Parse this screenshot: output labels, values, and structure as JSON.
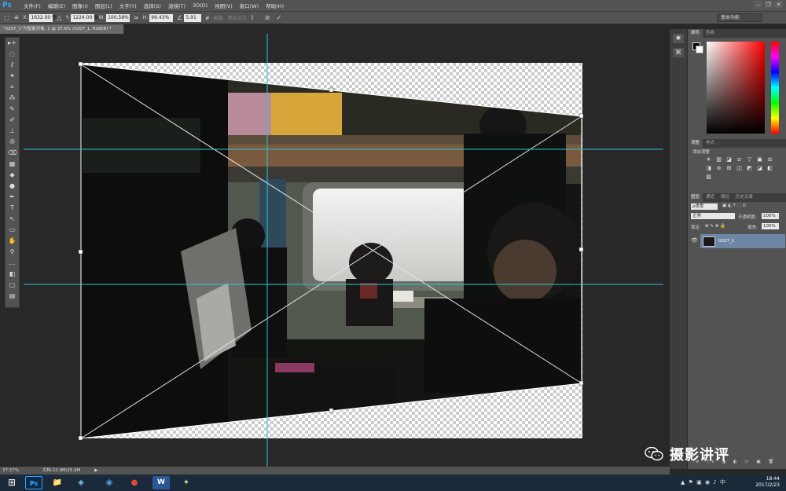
{
  "app": {
    "logo": "Ps"
  },
  "menu": [
    "文件(F)",
    "编辑(E)",
    "图像(I)",
    "图层(L)",
    "文字(Y)",
    "选择(S)",
    "滤镜(T)",
    "3D(D)",
    "视图(V)",
    "窗口(W)",
    "帮助(H)"
  ],
  "window_controls": {
    "minimize": "–",
    "restore": "❐",
    "close": "✕"
  },
  "options": {
    "x_label": "X:",
    "x_value": "1632.00 像",
    "y_label": "Y:",
    "y_value": "1224.00 像",
    "w_label": "W:",
    "w_value": "100.58%",
    "h_label": "H:",
    "h_value": "99.43%",
    "angle_value": "5.91",
    "interp_label": "插值:",
    "interp_value": "两次立方",
    "cancel_icon": "⊘",
    "commit_icon": "✓",
    "workspace": "基本功能"
  },
  "document_tab": "\"0207_1\"为智能对象, 1 @ 37.6% (0207_1, RGB/8) *",
  "tools": [
    "▸+",
    "◌",
    "ℓ",
    "✦",
    "⌗",
    "⁂",
    "✎",
    "✐",
    "⊥",
    "✇",
    "⌫",
    "▦",
    "◆",
    "●",
    "✒",
    "T",
    "↖",
    "▭",
    "✋",
    "⚲",
    "…",
    "◧",
    "▢",
    "▤"
  ],
  "panels": {
    "color_tabs": [
      "颜色",
      "色板"
    ],
    "adjust_tabs": [
      "调整",
      "样式"
    ],
    "adjust_hint": "添加调整",
    "adjust_icons": [
      "☀",
      "▥",
      "◪",
      "⧄",
      "▽",
      "▣",
      "⚖",
      "◨",
      "⊚",
      "⊞",
      "◫",
      "◩",
      "◪",
      "◧",
      "▨"
    ],
    "layer_tabs": [
      "图层",
      "通道",
      "路径",
      "历史记录"
    ],
    "kind_label": "ρ类型",
    "blend_mode": "正常",
    "opacity_label": "不透明度:",
    "opacity_value": "100%",
    "lock_label": "锁定:",
    "fill_label": "填充:",
    "fill_value": "100%",
    "layer_name": "0207_1"
  },
  "status": {
    "zoom": "37.57%",
    "doc_size": "文档:22.9M/25.9M"
  },
  "taskbar": {
    "apps": [
      "Ps",
      "📁",
      "◈",
      "◉",
      "●",
      "W",
      "✦"
    ],
    "time": "18:44",
    "date": "2017/2/23",
    "tray": "▲ ⚑ ▣ ◉ ♪ 中"
  },
  "watermark": "摄影讲评",
  "colors": {
    "guide": "#28c8d2",
    "selection": "#6d86a6",
    "ui_panel": "#535353",
    "ui_dark": "#282828"
  }
}
